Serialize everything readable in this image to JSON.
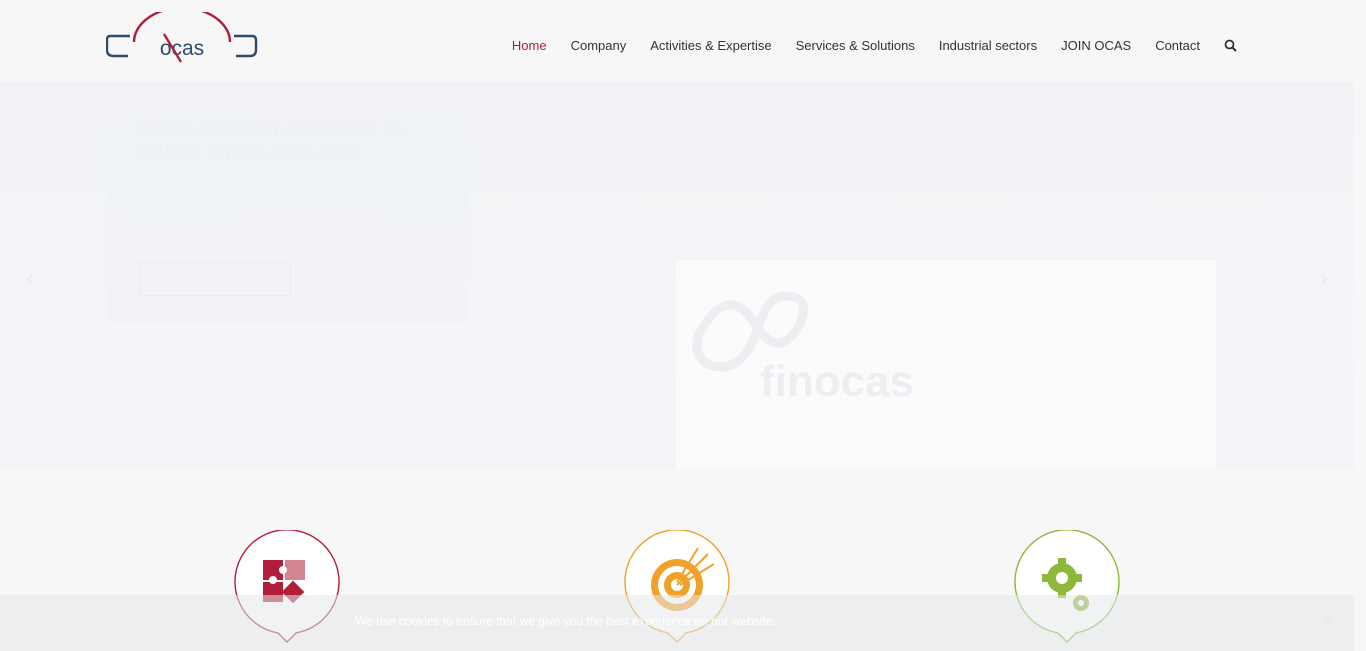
{
  "header": {
    "logo_text": "ocas",
    "nav": [
      {
        "label": "Home",
        "active": true
      },
      {
        "label": "Company",
        "active": false
      },
      {
        "label": "Activities & Expertise",
        "active": false
      },
      {
        "label": "Services & Solutions",
        "active": false
      },
      {
        "label": "Industrial sectors",
        "active": false
      },
      {
        "label": "JOIN OCAS",
        "active": false
      },
      {
        "label": "Contact",
        "active": false
      }
    ],
    "search_icon": "search-icon"
  },
  "slider": {
    "title": "FINOCAS Group publishes its activity report 2022-2023",
    "text": "",
    "button_label": "",
    "image_brand": "finocas",
    "prev_icon": "chevron-left-icon",
    "next_icon": "chevron-right-icon"
  },
  "features": [
    {
      "icon": "puzzle-icon",
      "color": "#b01e3a"
    },
    {
      "icon": "target-icon",
      "color": "#f0a12a"
    },
    {
      "icon": "gears-icon",
      "color": "#8db83a"
    }
  ],
  "cookie": {
    "text": "We use cookies to ensure that we give you the best experience on our website.",
    "link": "",
    "close_icon": "close-icon"
  },
  "colors": {
    "brand_red": "#b01e3a",
    "brand_blue": "#2e4a6d",
    "orange": "#f0a12a",
    "green": "#8db83a"
  }
}
